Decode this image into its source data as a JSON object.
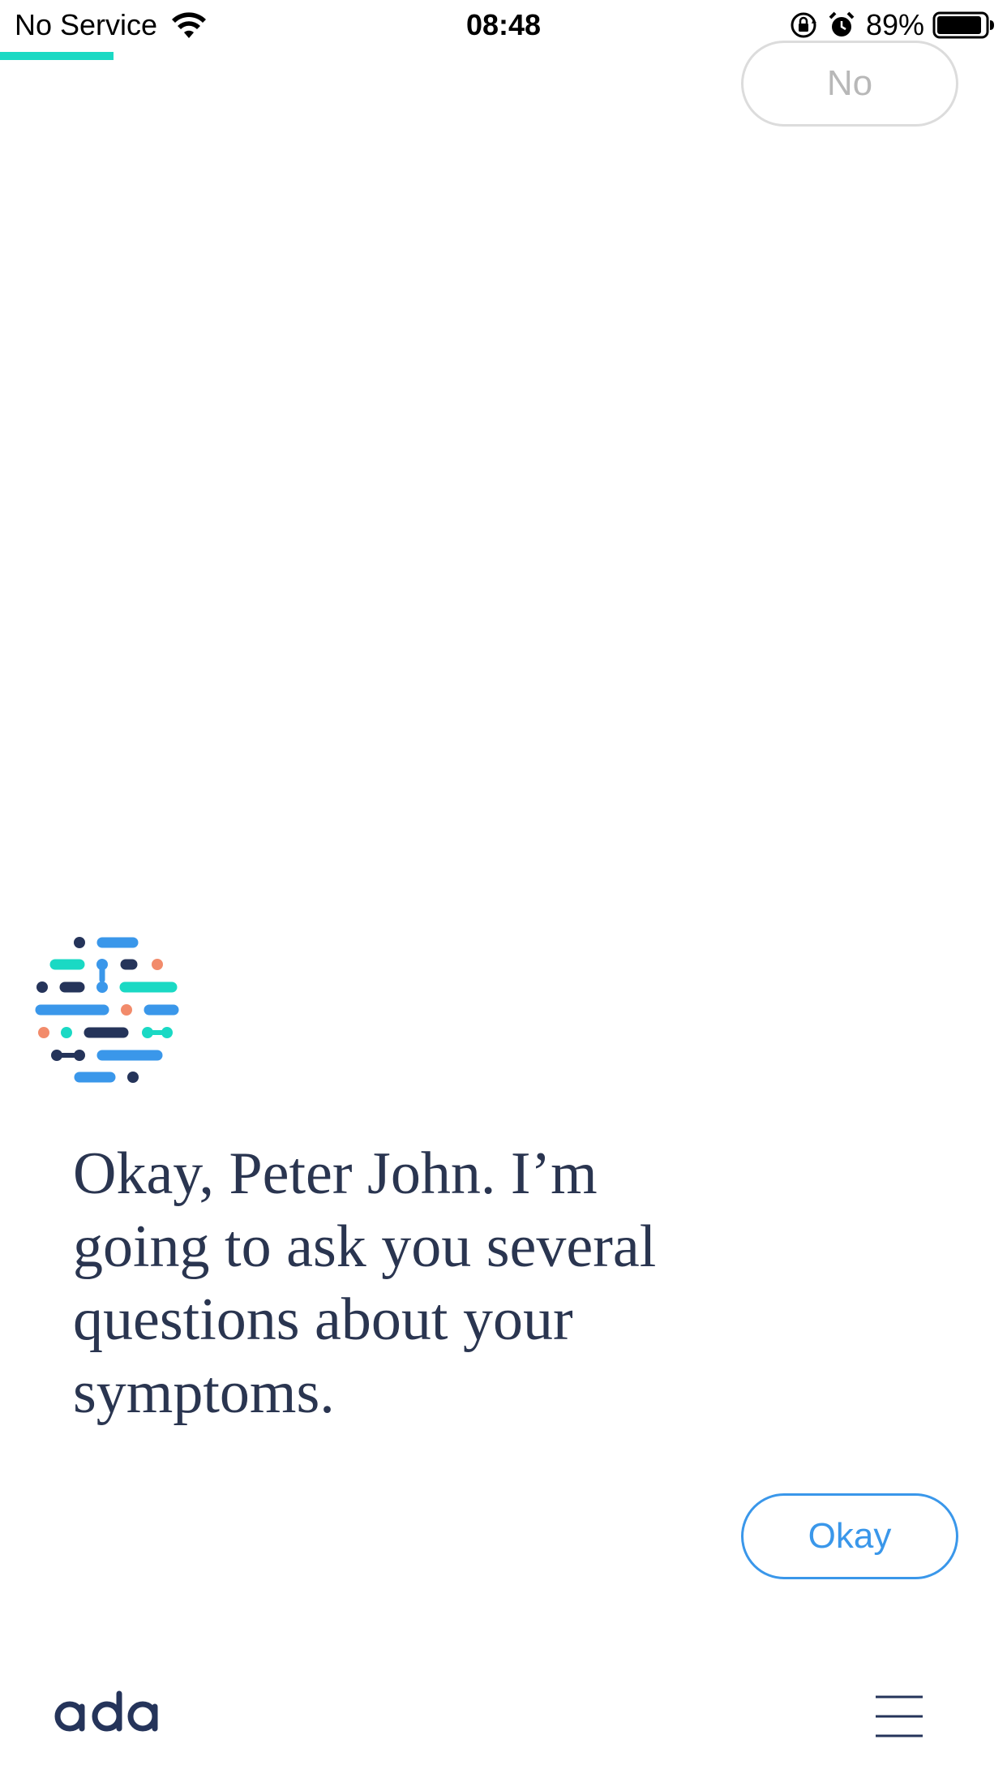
{
  "status_bar": {
    "carrier": "No Service",
    "time": "08:48",
    "battery": "89%",
    "icons": [
      "wifi-icon",
      "orientation-lock-icon",
      "alarm-icon",
      "battery-icon"
    ]
  },
  "progress": {
    "fraction": 0.113,
    "color": "#1ad9c4"
  },
  "answers": {
    "no_label": "No",
    "okay_label": "Okay"
  },
  "conversation": {
    "message": "Okay, Peter John. I’m going to ask you several questions about your symptoms."
  },
  "footer": {
    "logo_text": "ada",
    "menu_icon": "hamburger-menu-icon"
  },
  "colors": {
    "accent_blue": "#3a97ea",
    "teal": "#1ad9c4",
    "navy": "#25345a",
    "salmon": "#f28b6b",
    "disabled_gray": "#b8b8b8"
  }
}
